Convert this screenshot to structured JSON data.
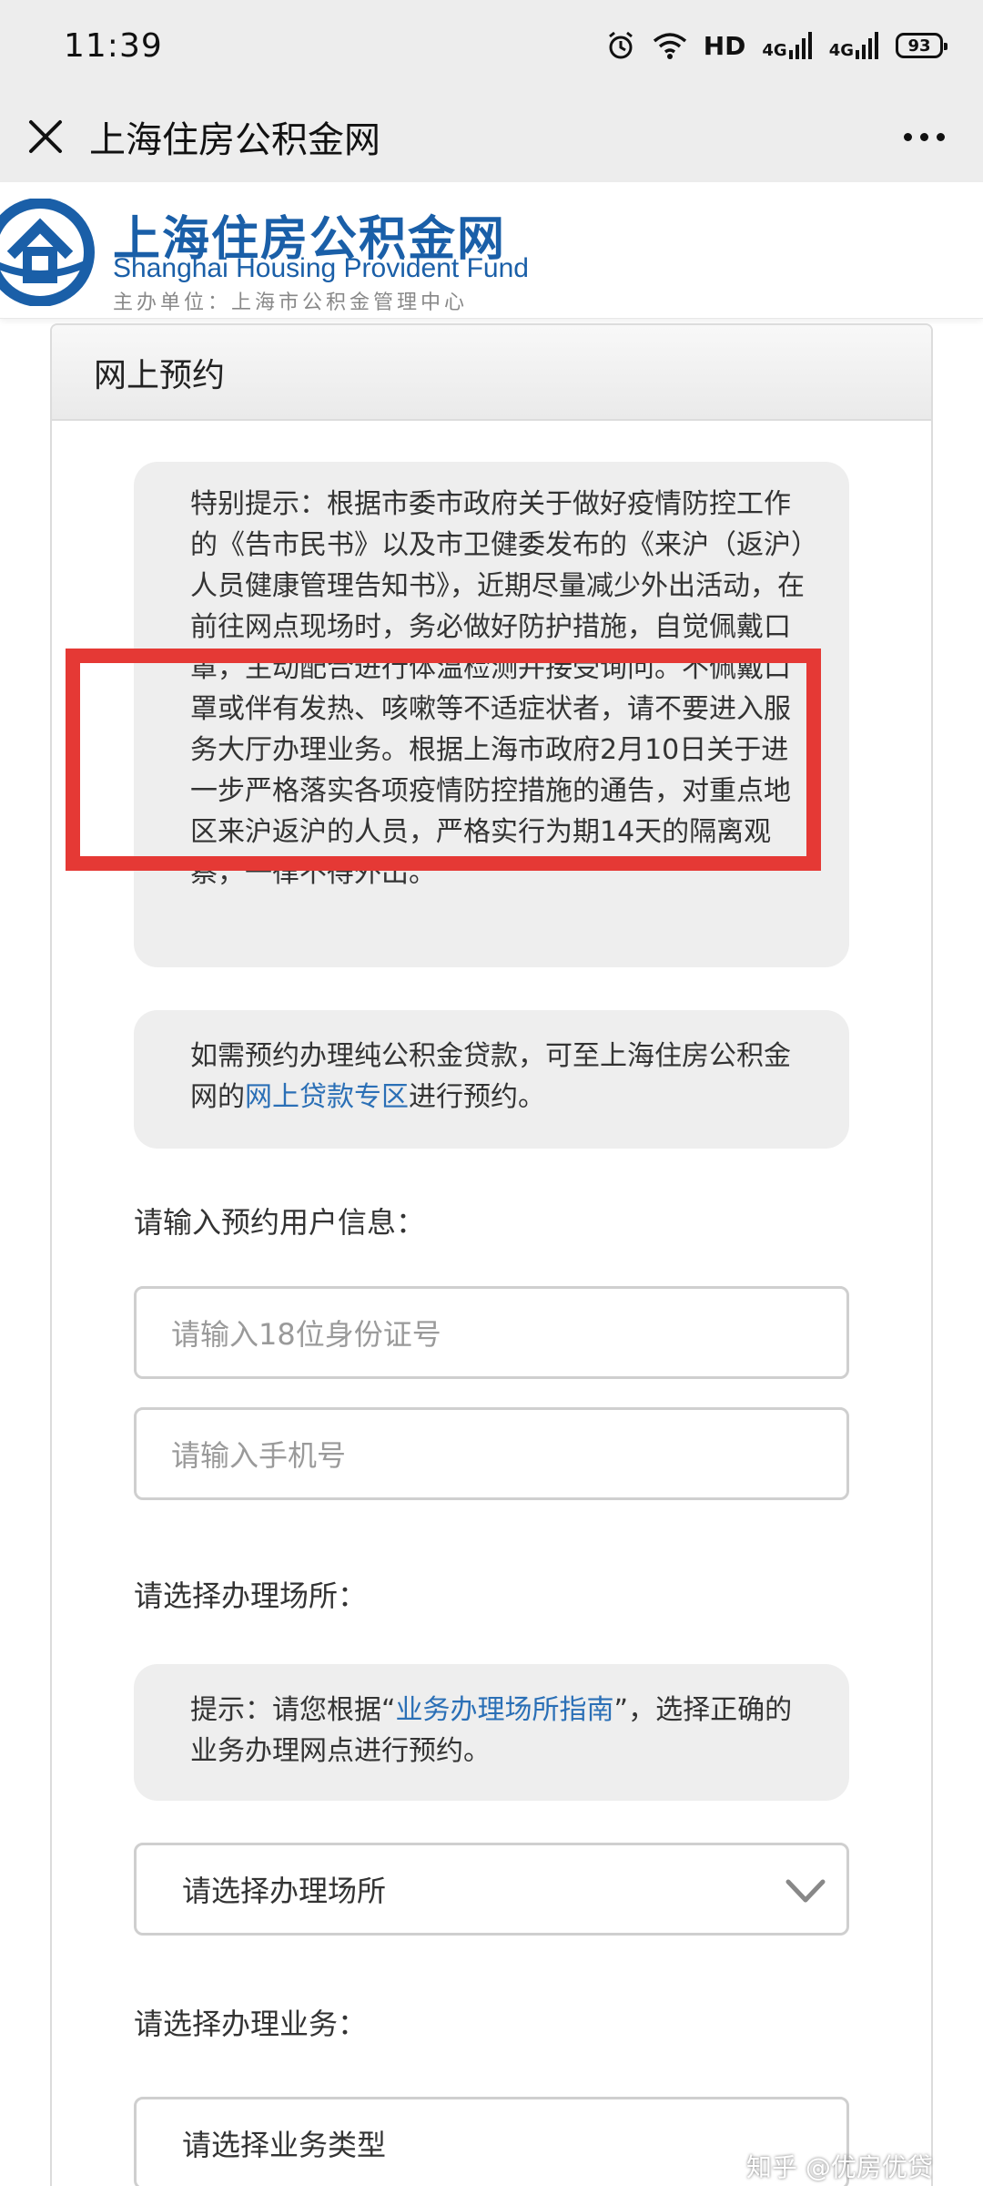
{
  "status_bar": {
    "time": "11:39",
    "network_label": "HD",
    "signal_1_label": "4G",
    "signal_2_label": "4G",
    "battery": "93"
  },
  "nav": {
    "title": "上海住房公积金网"
  },
  "site_header": {
    "name_cn": "上海住房公积金网",
    "name_en": "Shanghai Housing Provident Fund",
    "organizer": "主办单位：上海市公积金管理中心"
  },
  "card": {
    "title": "网上预约"
  },
  "notice_special": "特别提示：根据市委市政府关于做好疫情防控工作的《告市民书》以及市卫健委发布的《来沪（返沪）人员健康管理告知书》，近期尽量减少外出活动，在前往网点现场时，务必做好防护措施，自觉佩戴口罩，主动配合进行体温检测并接受询问。不佩戴口罩或伴有发热、咳嗽等不适症状者，请不要进入服务大厅办理业务。根据上海市政府2月10日关于进一步严格落实各项疫情防控措施的通告，对重点地区来沪返沪的人员，严格实行为期14天的隔离观察，一律不得外出。",
  "notice_loan": {
    "prefix": "如需预约办理纯公积金贷款，可至上海住房公积金网的",
    "link": "网上贷款专区",
    "suffix": "进行预约。"
  },
  "user_info": {
    "label": "请输入预约用户信息：",
    "id_placeholder": "请输入18位身份证号",
    "phone_placeholder": "请输入手机号"
  },
  "place": {
    "label": "请选择办理场所：",
    "tip_prefix": "提示：请您根据“",
    "tip_link": "业务办理场所指南",
    "tip_suffix": "”，选择正确的业务办理网点进行预约。",
    "select_value": "请选择办理场所"
  },
  "business": {
    "label": "请选择办理业务：",
    "select_value": "请选择业务类型"
  },
  "watermark": "知乎 @优房优贷",
  "colors": {
    "brand_blue": "#1a5fa8",
    "link_blue": "#2a6fb6",
    "highlight_red": "#e53935"
  }
}
